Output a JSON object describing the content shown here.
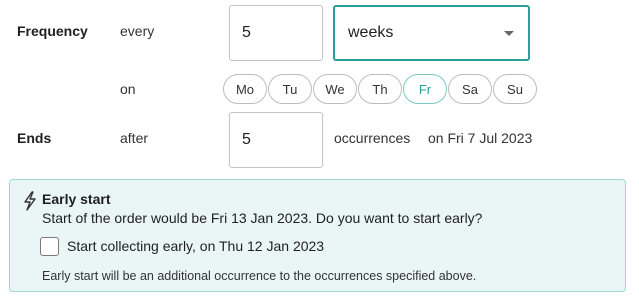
{
  "frequency": {
    "label": "Frequency",
    "every_label": "every",
    "interval_value": "5",
    "unit_value": "weeks",
    "on_label": "on",
    "days": [
      {
        "label": "Mo",
        "selected": false
      },
      {
        "label": "Tu",
        "selected": false
      },
      {
        "label": "We",
        "selected": false
      },
      {
        "label": "Th",
        "selected": false
      },
      {
        "label": "Fr",
        "selected": true
      },
      {
        "label": "Sa",
        "selected": false
      },
      {
        "label": "Su",
        "selected": false
      }
    ]
  },
  "ends": {
    "label": "Ends",
    "after_label": "after",
    "count_value": "5",
    "occurrences_label": "occurrences",
    "end_date_text": "on Fri 7 Jul 2023"
  },
  "early_start": {
    "title": "Early start",
    "description": "Start of the order would be Fri 13 Jan 2023. Do you want to start early?",
    "checkbox_label": "Start collecting early, on Thu 12 Jan 2023",
    "checked": false,
    "note": "Early start will be an additional occurrence to the occurrences specified above.",
    "icon": "lightning-icon"
  },
  "colors": {
    "accent": "#2b9e9a",
    "panel_bg": "#eaf6f6",
    "panel_border": "#9fd6d4"
  }
}
